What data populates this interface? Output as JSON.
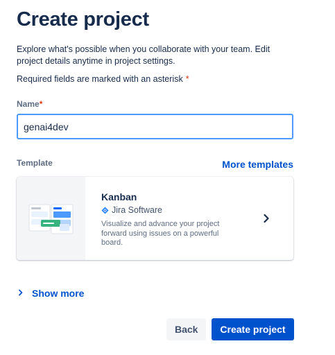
{
  "page": {
    "title": "Create project",
    "description": "Explore what's possible when you collaborate with your team. Edit project details anytime in project settings.",
    "required_note": "Required fields are marked with an asterisk",
    "required_marker": "*"
  },
  "name_field": {
    "label": "Name",
    "required_marker": "*",
    "value": "genai4dev"
  },
  "template": {
    "label": "Template",
    "more_templates_link": "More templates",
    "selected": {
      "name": "Kanban",
      "product": "Jira Software",
      "product_icon": "jira-logo-icon",
      "description": "Visualize and advance your project forward using issues on a powerful board.",
      "thumbnail_icon": "kanban-board-illustration",
      "chevron_icon": "chevron-right-icon"
    }
  },
  "show_more": {
    "label": "Show more",
    "icon": "chevron-right-icon"
  },
  "actions": {
    "back_label": "Back",
    "create_label": "Create project"
  },
  "colors": {
    "primary": "#0052CC",
    "focus_border": "#4C9AFF",
    "required": "#DE350B",
    "text": "#172B4D",
    "subtle_text": "#5E6C84"
  }
}
